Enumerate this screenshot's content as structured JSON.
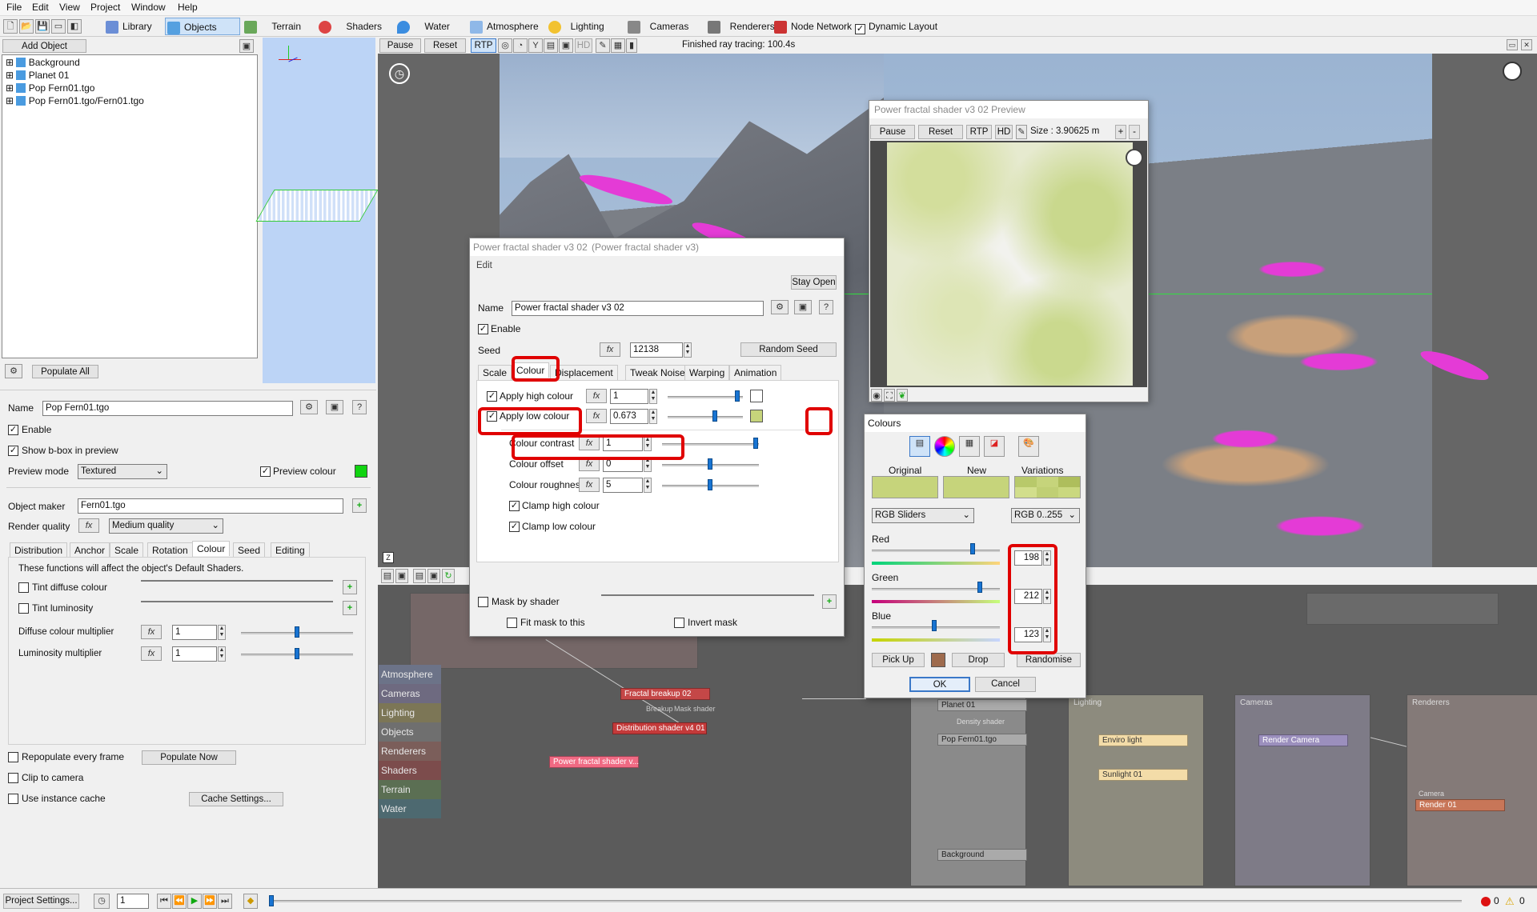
{
  "menubar": {
    "items": [
      "File",
      "Edit",
      "View",
      "Project",
      "Window",
      "Help"
    ]
  },
  "toolbar": {
    "tabs": [
      "Library",
      "Objects",
      "Terrain",
      "Shaders",
      "Water",
      "Atmosphere",
      "Lighting",
      "Cameras",
      "Renderers",
      "Node Network"
    ],
    "dynamic_layout": "Dynamic Layout",
    "dynamic_layout_checked": true
  },
  "objects_panel": {
    "add_object": "Add Object",
    "tree": [
      "Background",
      "Planet 01",
      "Pop Fern01.tgo",
      "Pop Fern01.tgo/Fern01.tgo"
    ],
    "populate_all": "Populate All"
  },
  "render_toolbar": {
    "pause": "Pause",
    "reset": "Reset",
    "rtp": "RTP",
    "hd": "HD",
    "status": "Finished ray tracing: 100.4s"
  },
  "object_props": {
    "name_label": "Name",
    "name_value": "Pop Fern01.tgo",
    "enable": "Enable",
    "show_bbox": "Show b-box in preview",
    "preview_mode_label": "Preview mode",
    "preview_mode_value": "Textured",
    "preview_colour": "Preview colour",
    "object_maker_label": "Object maker",
    "object_maker_value": "Fern01.tgo",
    "render_quality_label": "Render quality",
    "render_quality_value": "Medium quality",
    "tabs": [
      "Distribution",
      "Anchor",
      "Scale",
      "Rotation",
      "Colour",
      "Seed",
      "Editing"
    ],
    "info": "These functions will affect the object's Default Shaders.",
    "tint_diffuse": "Tint diffuse colour",
    "tint_luminosity": "Tint luminosity",
    "diffuse_mult_label": "Diffuse colour multiplier",
    "diffuse_mult_value": "1",
    "lum_mult_label": "Luminosity multiplier",
    "lum_mult_value": "1",
    "repopulate": "Repopulate every frame",
    "populate_now": "Populate Now",
    "clip": "Clip to camera",
    "instance_cache": "Use instance cache",
    "cache_settings": "Cache Settings..."
  },
  "node_sidebar": [
    "Atmosphere",
    "Cameras",
    "Lighting",
    "Objects",
    "Renderers",
    "Shaders",
    "Terrain",
    "Water"
  ],
  "nodes": {
    "fractal_breakup": "Fractal breakup 02",
    "breakup_label": "Breakup",
    "mask_shader_label": "Mask shader",
    "distribution_shader": "Distribution shader v4 01",
    "power_fractal": "Power fractal shader v...",
    "planet": "Planet 01",
    "density_label": "Density shader",
    "pop_fern": "Pop Fern01.tgo",
    "background": "Background",
    "lighting_group": "Lighting",
    "enviro_light": "Enviro light",
    "sunlight": "Sunlight 01",
    "cameras_group": "Cameras",
    "render_camera": "Render Camera",
    "renderers_group": "Renderers",
    "camera_label": "Camera",
    "render01": "Render 01"
  },
  "shader_dialog": {
    "title": "Power fractal shader v3 02",
    "subtitle": "(Power fractal shader v3)",
    "menu": "Edit",
    "stay_open": "Stay Open",
    "name_label": "Name",
    "name_value": "Power fractal shader v3 02",
    "enable": "Enable",
    "seed_label": "Seed",
    "seed_value": "12138",
    "random_seed": "Random Seed",
    "tabs": [
      "Scale",
      "Colour",
      "Displacement",
      "Tweak Noise",
      "Warping",
      "Animation"
    ],
    "apply_high": "Apply high colour",
    "apply_high_value": "1",
    "apply_low": "Apply low colour",
    "apply_low_value": "0.673",
    "contrast": "Colour contrast",
    "contrast_value": "1",
    "offset": "Colour offset",
    "offset_value": "0",
    "roughness": "Colour roughness",
    "roughness_value": "5",
    "clamp_high": "Clamp high colour",
    "clamp_low": "Clamp low colour",
    "mask": "Mask by shader",
    "fit_mask": "Fit mask to this",
    "invert_mask": "Invert mask",
    "low_colour_hex": "#c6d47b"
  },
  "preview_window": {
    "title": "Power fractal shader v3 02 Preview",
    "pause": "Pause",
    "reset": "Reset",
    "rtp": "RTP",
    "hd": "HD",
    "size": "Size : 3.90625 m",
    "plus": "+",
    "minus": "-"
  },
  "colours_dialog": {
    "title": "Colours",
    "original": "Original",
    "new": "New",
    "variations": "Variations",
    "mode": "RGB Sliders",
    "range": "RGB 0..255",
    "red_label": "Red",
    "red": "198",
    "green_label": "Green",
    "green": "212",
    "blue_label": "Blue",
    "blue": "123",
    "red_fraction": 0.776,
    "green_fraction": 0.831,
    "blue_fraction": 0.482,
    "pick_up": "Pick Up",
    "drop": "Drop",
    "randomise": "Randomise",
    "ok": "OK",
    "cancel": "Cancel",
    "colour_hex": "#c6d47b"
  },
  "bottom_bar": {
    "project_settings": "Project Settings...",
    "frame": "1",
    "errors": "0",
    "warnings": "0"
  }
}
